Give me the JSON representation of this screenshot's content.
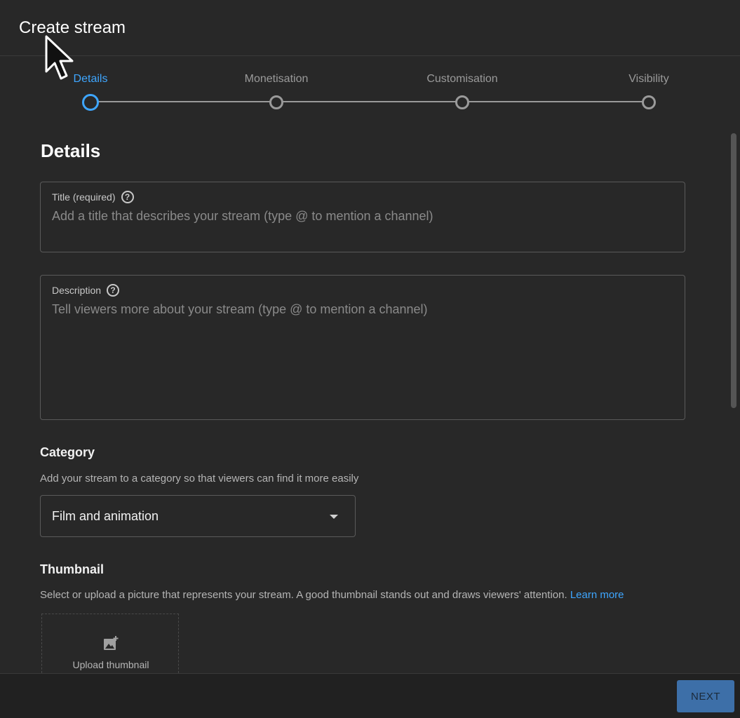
{
  "header": {
    "title": "Create stream"
  },
  "stepper": {
    "steps": [
      {
        "label": "Details",
        "active": true
      },
      {
        "label": "Monetisation",
        "active": false
      },
      {
        "label": "Customisation",
        "active": false
      },
      {
        "label": "Visibility",
        "active": false
      }
    ]
  },
  "details": {
    "heading": "Details",
    "title_field": {
      "label": "Title (required)",
      "placeholder": "Add a title that describes your stream (type @ to mention a channel)",
      "value": ""
    },
    "description_field": {
      "label": "Description",
      "placeholder": "Tell viewers more about your stream (type @ to mention a channel)",
      "value": ""
    },
    "help_icon": "help-circle-icon"
  },
  "category": {
    "heading": "Category",
    "text": "Add your stream to a category so that viewers can find it more easily",
    "selected": "Film and animation"
  },
  "thumbnail": {
    "heading": "Thumbnail",
    "text": "Select or upload a picture that represents your stream. A good thumbnail stands out and draws viewers' attention.",
    "link": "Learn more",
    "upload_label": "Upload thumbnail"
  },
  "footer": {
    "next_label": "NEXT"
  },
  "colors": {
    "accent": "#3ea6ff",
    "background": "#282828",
    "button": "#3d6fa8"
  }
}
